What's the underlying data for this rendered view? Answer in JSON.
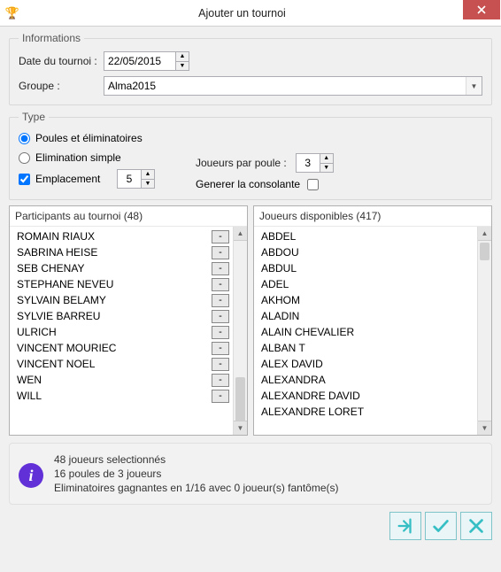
{
  "window": {
    "title": "Ajouter un tournoi"
  },
  "informations": {
    "legend": "Informations",
    "date_label": "Date du tournoi :",
    "date_value": "22/05/2015",
    "group_label": "Groupe :",
    "group_value": "Alma2015"
  },
  "type": {
    "legend": "Type",
    "option_pools": "Poules et éliminatoires",
    "option_simple": "Elimination simple",
    "selected": "pools",
    "placement_label": "Emplacement",
    "placement_checked": true,
    "placement_value": "5",
    "players_per_pool_label": "Joueurs par poule :",
    "players_per_pool_value": "3",
    "generate_consolation_label": "Generer la consolante",
    "generate_consolation_checked": false
  },
  "participants": {
    "header": "Participants au tournoi (48)",
    "count": 48,
    "visible": [
      "ROMAIN RIAUX",
      "SABRINA HEISE",
      "SEB CHENAY",
      "STEPHANE NEVEU",
      "SYLVAIN  BELAMY",
      "SYLVIE BARREU",
      "ULRICH",
      "VINCENT MOURIEC",
      "VINCENT NOEL",
      "WEN",
      "WILL"
    ]
  },
  "available": {
    "header": "Joueurs disponibles (417)",
    "count": 417,
    "visible": [
      "ABDEL",
      "ABDOU",
      "ABDUL",
      "ADEL",
      "AKHOM",
      "ALADIN",
      "ALAIN CHEVALIER",
      "ALBAN T",
      "ALEX DAVID",
      "ALEXANDRA",
      "ALEXANDRE DAVID",
      "ALEXANDRE LORET"
    ]
  },
  "summary": {
    "line1": "48 joueurs selectionnés",
    "line2": "16 poules de 3 joueurs",
    "line3": "Eliminatoires gagnantes en 1/16 avec 0 joueur(s) fantôme(s)"
  },
  "colors": {
    "accent": "#35bfc4",
    "info": "#6131d7",
    "close": "#c75050"
  }
}
